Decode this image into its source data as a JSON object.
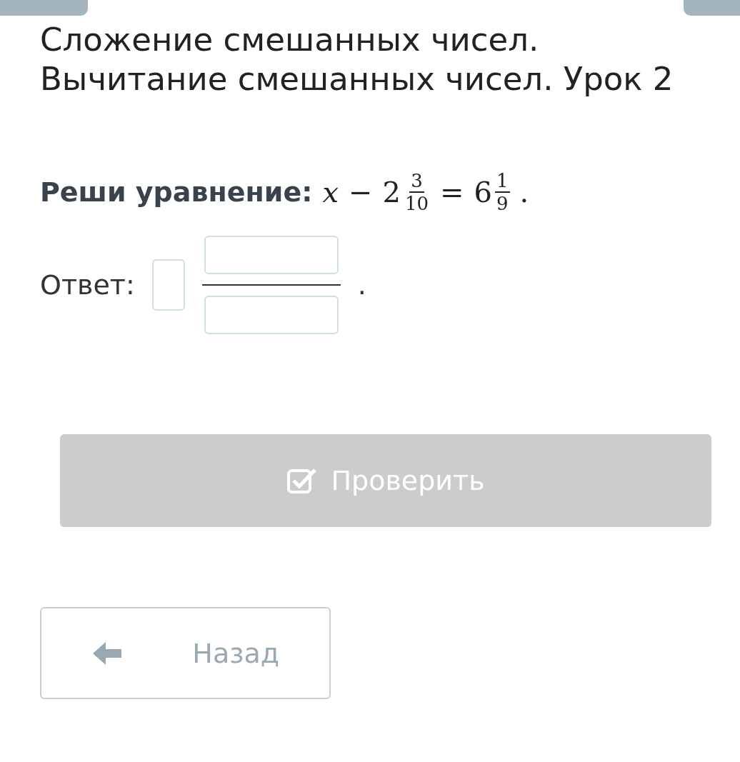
{
  "title": "Сложение смешанных чисел. Вычитание смешанных чисел. Урок 2",
  "task": {
    "label": "Реши уравнение:",
    "variable": "x",
    "operator": "−",
    "first": {
      "whole": "2",
      "numerator": "3",
      "denominator": "10"
    },
    "equals": "=",
    "second": {
      "whole": "6",
      "numerator": "1",
      "denominator": "9"
    },
    "end": "."
  },
  "answer": {
    "label": "Ответ:",
    "end": "."
  },
  "check_button": {
    "label": "Проверить",
    "disabled": true
  },
  "back_button": {
    "label": "Назад"
  }
}
